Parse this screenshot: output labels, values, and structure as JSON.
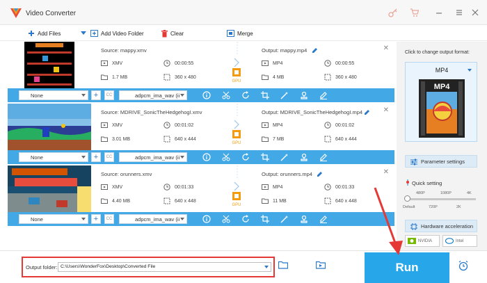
{
  "window": {
    "title": "Video Converter"
  },
  "toolbar": {
    "add_files": "Add Files",
    "add_video_folder": "Add Video Folder",
    "clear": "Clear",
    "merge": "Merge"
  },
  "items": [
    {
      "source": "Source: mappy.xmv",
      "output": "Output: mappy.mp4",
      "src_format": "XMV",
      "src_duration": "00:00:55",
      "src_size": "1.7 MB",
      "src_res": "360 x 480",
      "out_format": "MP4",
      "out_duration": "00:00:55",
      "out_size": "4 MB",
      "out_res": "360 x 480",
      "subtitle": "None",
      "audio": "adpcm_ima_wav (ii"
    },
    {
      "source": "Source: MDRIVE_SonicTheHedgehogI.xmv",
      "output": "Output: MDRIVE_SonicTheHedgehogI.mp4",
      "src_format": "XMV",
      "src_duration": "00:01:02",
      "src_size": "3.01 MB",
      "src_res": "640 x 444",
      "out_format": "MP4",
      "out_duration": "00:01:02",
      "out_size": "7 MB",
      "out_res": "640 x 444",
      "subtitle": "None",
      "audio": "adpcm_ima_wav (ii"
    },
    {
      "source": "Source: orunners.xmv",
      "output": "Output: orunners.mp4",
      "src_format": "XMV",
      "src_duration": "00:01:33",
      "src_size": "4.40 MB",
      "src_res": "640 x 448",
      "out_format": "MP4",
      "out_duration": "00:01:33",
      "out_size": "11 MB",
      "out_res": "640 x 448",
      "subtitle": "None",
      "audio": "adpcm_ima_wav (ii"
    }
  ],
  "gpu_label": "GPU",
  "cc_label": "CC",
  "right_panel": {
    "hint": "Click to change output format:",
    "format": "MP4",
    "format_badge": "MP4",
    "parameter_settings": "Parameter settings",
    "quick_setting": "Quick setting",
    "ticks_top": [
      "480P",
      "1080P",
      "4K"
    ],
    "ticks_bottom": [
      "Default",
      "720P",
      "2K"
    ],
    "quality_level": 0,
    "hardware_acceleration": "Hardware acceleration",
    "nvidia": "NVIDIA",
    "intel": "Intel"
  },
  "bottom": {
    "output_folder_label": "Output folder:",
    "output_folder_path": "C:\\Users\\WonderFox\\Desktop\\Converted File",
    "run": "Run"
  },
  "colors": {
    "accent": "#27a6ea",
    "option_bar": "#43a8e6",
    "highlight": "#e53935"
  }
}
